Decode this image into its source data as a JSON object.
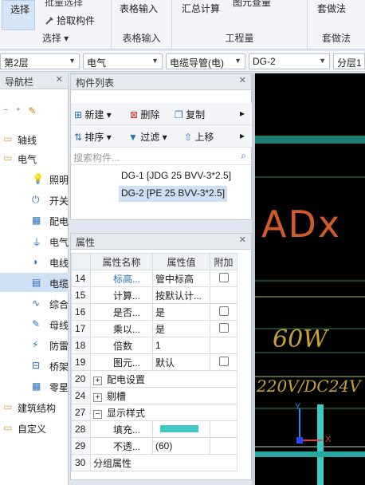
{
  "ribbon": {
    "select_btn": "选择",
    "partial_top": "批量选择",
    "pick_component": "拾取构件",
    "select_group": "选择",
    "table_input_btn": "表格输入",
    "table_input_group": "表格输入",
    "summary_calc": "汇总计算",
    "partial_right": "图元查量",
    "quantity_group": "工程量",
    "method_btn": "套做法",
    "method_group": "套做法"
  },
  "filters": {
    "floor": "第2层",
    "major": "电气",
    "type": "电缆导管(电)",
    "item": "DG-2",
    "layer": "分层1"
  },
  "nav": {
    "title": "导航栏",
    "items": [
      {
        "label": "轴线",
        "icon": "folder-icon"
      },
      {
        "label": "电气",
        "icon": "folder-icon"
      },
      {
        "label": "照明灯具",
        "icon": "bulb-icon"
      },
      {
        "label": "开关插座",
        "icon": "switch-icon"
      },
      {
        "label": "配电箱柜",
        "icon": "panel-icon"
      },
      {
        "label": "电气设备",
        "icon": "plug-icon"
      },
      {
        "label": "电线导管",
        "icon": "pipe-icon"
      },
      {
        "label": "电缆导管",
        "icon": "cable-icon"
      },
      {
        "label": "综合管线",
        "icon": "line-icon"
      },
      {
        "label": "母线",
        "icon": "pen-icon"
      },
      {
        "label": "防雷接地",
        "icon": "lightning-icon"
      },
      {
        "label": "桥架",
        "icon": "tray-icon"
      },
      {
        "label": "零星构件",
        "icon": "grid-icon"
      },
      {
        "label": "建筑结构",
        "icon": "folder-icon"
      },
      {
        "label": "自定义",
        "icon": "folder-icon"
      }
    ]
  },
  "components": {
    "title": "构件列表",
    "new": "新建",
    "delete": "删除",
    "copy": "复制",
    "sort": "排序",
    "filter": "过滤",
    "move_up": "上移",
    "search_placeholder": "搜索构件...",
    "items": [
      "DG-1 [JDG 25 BVV-3*2.5]",
      "DG-2 [PE 25 BVV-3*2.5]"
    ]
  },
  "properties": {
    "title": "属性",
    "headers": [
      "属性名称",
      "属性值",
      "附加"
    ],
    "rows": [
      {
        "num": "14",
        "name": "标高...",
        "value": "管中标高",
        "check": true
      },
      {
        "num": "15",
        "name": "计算...",
        "value": "按默认计...",
        "check": false
      },
      {
        "num": "16",
        "name": "是否...",
        "value": "是",
        "check": true
      },
      {
        "num": "17",
        "name": "乘以...",
        "value": "是",
        "check": true
      },
      {
        "num": "18",
        "name": "倍数",
        "value": "1",
        "check": false
      },
      {
        "num": "19",
        "name": "图元...",
        "value": "默认",
        "check": true
      },
      {
        "num": "20",
        "name": "配电设置",
        "value": "",
        "check": false
      },
      {
        "num": "24",
        "name": "剔槽",
        "value": "",
        "check": false
      },
      {
        "num": "27",
        "name": "显示样式",
        "value": "",
        "check": false
      },
      {
        "num": "28",
        "name": "填充...",
        "value": "",
        "check": false
      },
      {
        "num": "29",
        "name": "不透...",
        "value": "(60)",
        "check": false
      },
      {
        "num": "30",
        "name": "分组属性",
        "value": "",
        "check": false
      }
    ],
    "fill_color": "#3ec9c4"
  },
  "canvas": {
    "text_top": "ADx",
    "text_power": "60W",
    "text_voltage": "220V/DC24V",
    "axis_y": "Y",
    "axis_x": "X"
  }
}
